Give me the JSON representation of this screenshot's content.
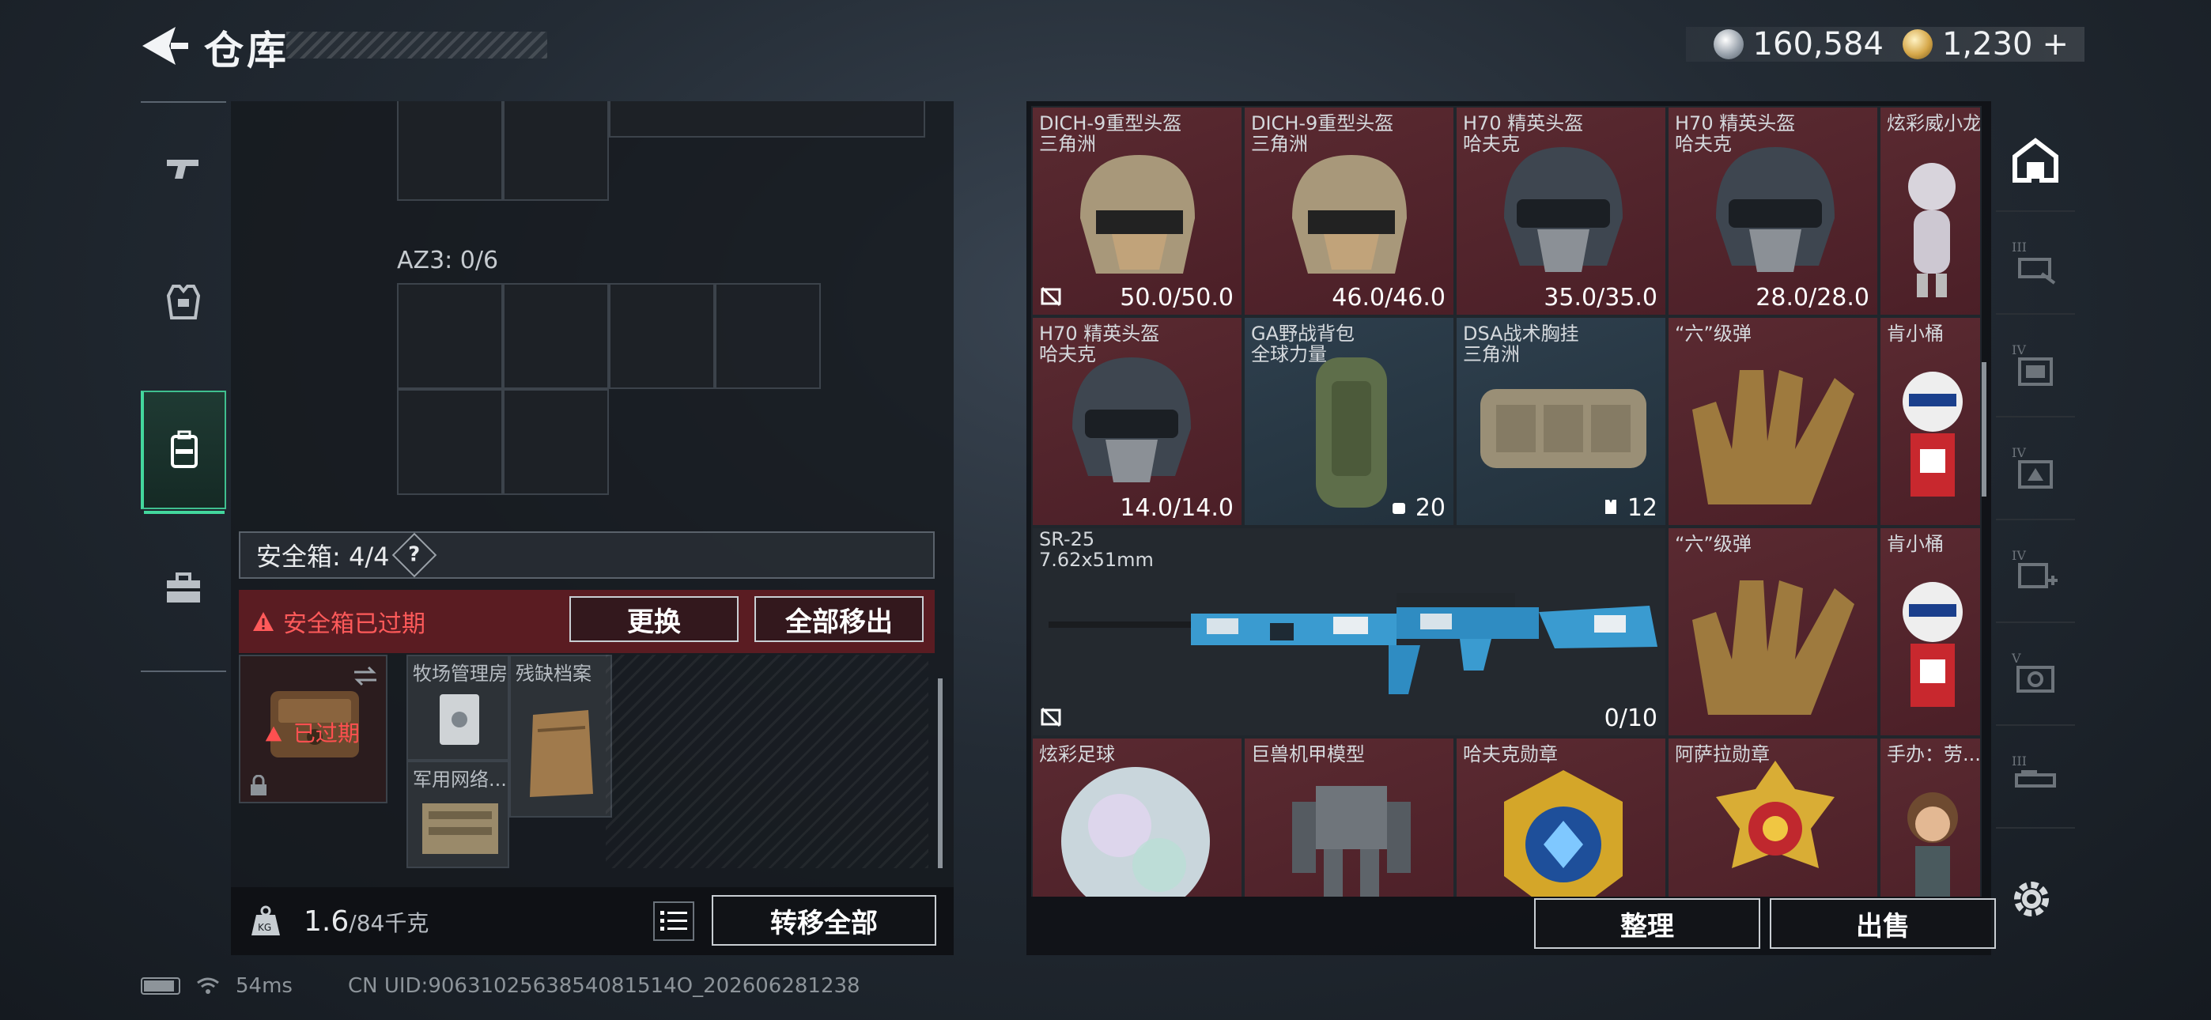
{
  "header": {
    "title": "仓库"
  },
  "currency": [
    {
      "icon": "silver-coin-icon",
      "value": "160,584"
    },
    {
      "icon": "gold-coin-icon",
      "value": "1,230",
      "add": "+"
    }
  ],
  "left_categories": [
    {
      "icon": "pistol-icon",
      "active": false
    },
    {
      "icon": "armor-icon",
      "active": false
    },
    {
      "icon": "backpack-icon",
      "active": true
    },
    {
      "icon": "toolbox-icon",
      "active": false
    }
  ],
  "storage": {
    "az3_label": "AZ3: 0/6",
    "safe_box_label": "安全箱: 4/4",
    "help": "?",
    "expired_warning": "安全箱已过期",
    "replace_button": "更换",
    "move_all_button": "全部移出",
    "case_status": "已过期",
    "safe_items": [
      {
        "name": "牧场管理房"
      },
      {
        "name": "残缺档案"
      },
      {
        "name": "军用网络..."
      }
    ],
    "weight_current": "1.6",
    "weight_max": "/84千克",
    "transfer_all_button": "转移全部"
  },
  "inventory": {
    "items": [
      {
        "name": "DICH-9重型头盔",
        "sub": "三角洲",
        "durability": "50.0/50.0",
        "rarity": "red"
      },
      {
        "name": "DICH-9重型头盔",
        "sub": "三角洲",
        "durability": "46.0/46.0",
        "rarity": "red"
      },
      {
        "name": "H70 精英头盔",
        "sub": "哈夫克",
        "durability": "35.0/35.0",
        "rarity": "red"
      },
      {
        "name": "H70 精英头盔",
        "sub": "哈夫克",
        "durability": "28.0/28.0",
        "rarity": "red"
      },
      {
        "name": "炫彩威小龙",
        "sub": "",
        "durability": "",
        "rarity": "red"
      },
      {
        "name": "H70 精英头盔",
        "sub": "哈夫克",
        "durability": "14.0/14.0",
        "rarity": "red"
      },
      {
        "name": "GA野战背包",
        "sub": "全球力量",
        "durability": "20",
        "rarity": "blue"
      },
      {
        "name": "DSA战术胸挂",
        "sub": "三角洲",
        "durability": "12",
        "rarity": "blue"
      },
      {
        "name": "“六”级弹",
        "sub": "",
        "durability": "",
        "rarity": "red"
      },
      {
        "name": "肯小桶",
        "sub": "",
        "durability": "",
        "rarity": "red"
      },
      {
        "name": "SR-25",
        "sub": "7.62x51mm",
        "durability": "0/10",
        "rarity": "dark"
      },
      {
        "name": "“六”级弹",
        "sub": "",
        "durability": "",
        "rarity": "red"
      },
      {
        "name": "肯小桶",
        "sub": "",
        "durability": "",
        "rarity": "red"
      },
      {
        "name": "炫彩足球",
        "sub": "",
        "durability": "",
        "rarity": "red"
      },
      {
        "name": "巨兽机甲模型",
        "sub": "",
        "durability": "",
        "rarity": "red"
      },
      {
        "name": "哈夫克勋章",
        "sub": "",
        "durability": "",
        "rarity": "red"
      },
      {
        "name": "阿萨拉勋章",
        "sub": "",
        "durability": "",
        "rarity": "red"
      },
      {
        "name": "手办：劳...",
        "sub": "",
        "durability": "",
        "rarity": "red"
      }
    ],
    "sort_button": "整理",
    "sell_button": "出售"
  },
  "right_tabs": [
    {
      "icon": "house-icon",
      "label": ""
    },
    {
      "icon": "storage-tab-icon",
      "label": "III"
    },
    {
      "icon": "storage-tab-icon",
      "label": "IV"
    },
    {
      "icon": "storage-tab-icon",
      "label": "IV"
    },
    {
      "icon": "storage-tab-icon",
      "label": "IV"
    },
    {
      "icon": "storage-tab-icon",
      "label": "V"
    },
    {
      "icon": "storage-tab-icon",
      "label": "III"
    }
  ],
  "status": {
    "ping": "54ms",
    "uid": "CN UID:9063102563854081514O_202606281238"
  },
  "colors": {
    "accent": "#43d79d",
    "warning": "#ff5a5a",
    "rarity_red": "#5a2a31",
    "rarity_blue": "#2e3f4d"
  }
}
